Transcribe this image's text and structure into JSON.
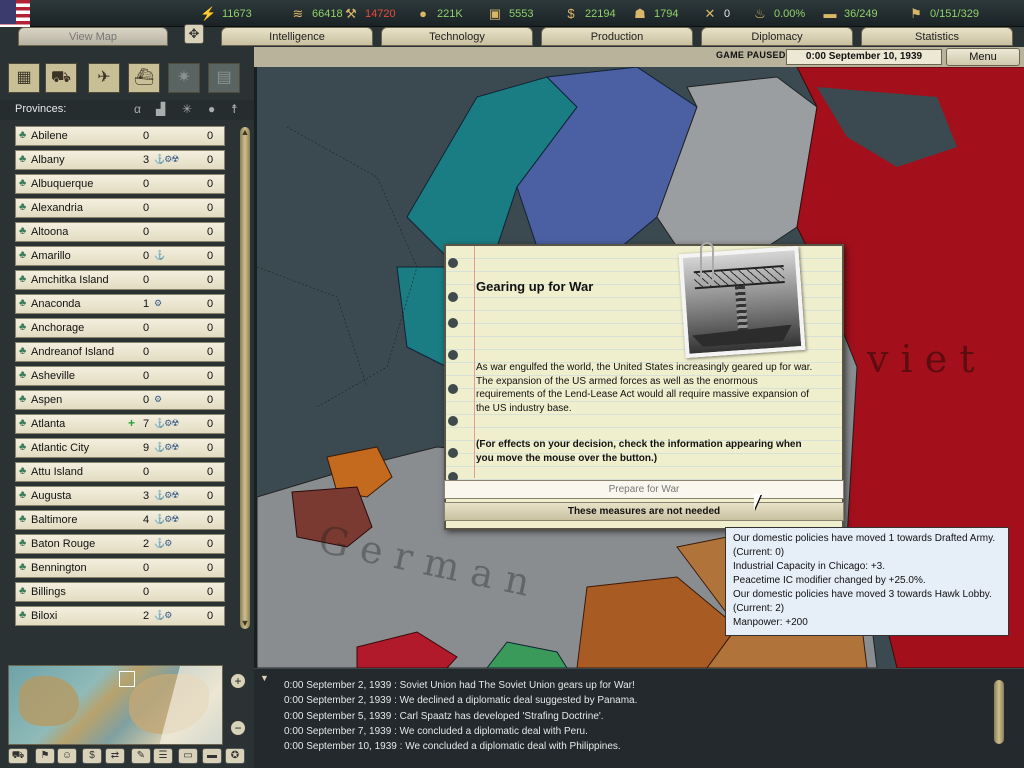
{
  "resources": [
    {
      "name": "energy",
      "icon": "lightning-icon",
      "value": "11673",
      "style": "green",
      "left": 0
    },
    {
      "name": "metal",
      "icon": "metal-bars-icon",
      "value": "66418",
      "style": "green"
    },
    {
      "name": "rare-materials",
      "icon": "rare-materials-icon",
      "value": "14720",
      "style": "red"
    },
    {
      "name": "oil",
      "icon": "oil-drop-icon",
      "value": "221K",
      "style": "green"
    },
    {
      "name": "supplies",
      "icon": "supplies-crate-icon",
      "value": "5553",
      "style": "green"
    },
    {
      "name": "money",
      "icon": "money-icon",
      "value": "22194",
      "style": "green"
    },
    {
      "name": "manpower",
      "icon": "manpower-icon",
      "value": "1794",
      "style": "green"
    },
    {
      "name": "nukes",
      "icon": "nuke-icon",
      "value": "0",
      "style": "white"
    },
    {
      "name": "dissent",
      "icon": "dissent-icon",
      "value": "0.00%",
      "style": "green"
    },
    {
      "name": "transport",
      "icon": "convoy-icon",
      "value": "36/249",
      "style": "green"
    },
    {
      "name": "ic",
      "icon": "industry-icon",
      "value": "0/151/329",
      "style": "green"
    }
  ],
  "tabs": [
    "View Map",
    "Intelligence",
    "Technology",
    "Production",
    "Diplomacy",
    "Statistics"
  ],
  "status": {
    "paused": "GAME PAUSED",
    "date": "0:00 September 10, 1939",
    "menu": "Menu"
  },
  "map_modes": [
    "terrain-mode-icon",
    "land-units-mode-icon",
    "air-mode-icon",
    "naval-mode-icon",
    "weather-mode-icon",
    "supply-mode-icon"
  ],
  "provinces_header": "Provinces:",
  "provinces": [
    {
      "name": "Abilene",
      "v1": "0",
      "icons": "",
      "v2": "0",
      "plus": false
    },
    {
      "name": "Albany",
      "v1": "3",
      "icons": "⚓⚙☢",
      "v2": "0",
      "plus": false
    },
    {
      "name": "Albuquerque",
      "v1": "0",
      "icons": "",
      "v2": "0",
      "plus": false
    },
    {
      "name": "Alexandria",
      "v1": "0",
      "icons": "",
      "v2": "0",
      "plus": false
    },
    {
      "name": "Altoona",
      "v1": "0",
      "icons": "",
      "v2": "0",
      "plus": false
    },
    {
      "name": "Amarillo",
      "v1": "0",
      "icons": "⚓",
      "v2": "0",
      "plus": false
    },
    {
      "name": "Amchitka Island",
      "v1": "0",
      "icons": "",
      "v2": "0",
      "plus": false
    },
    {
      "name": "Anaconda",
      "v1": "1",
      "icons": "⚙",
      "v2": "0",
      "plus": false
    },
    {
      "name": "Anchorage",
      "v1": "0",
      "icons": "",
      "v2": "0",
      "plus": false
    },
    {
      "name": "Andreanof Island",
      "v1": "0",
      "icons": "",
      "v2": "0",
      "plus": false
    },
    {
      "name": "Asheville",
      "v1": "0",
      "icons": "",
      "v2": "0",
      "plus": false
    },
    {
      "name": "Aspen",
      "v1": "0",
      "icons": "⚙",
      "v2": "0",
      "plus": false
    },
    {
      "name": "Atlanta",
      "v1": "7",
      "icons": "⚓⚙☢",
      "v2": "0",
      "plus": true
    },
    {
      "name": "Atlantic City",
      "v1": "9",
      "icons": "⚓⚙☢",
      "v2": "0",
      "plus": false
    },
    {
      "name": "Attu Island",
      "v1": "0",
      "icons": "",
      "v2": "0",
      "plus": false
    },
    {
      "name": "Augusta",
      "v1": "3",
      "icons": "⚓⚙☢",
      "v2": "0",
      "plus": false
    },
    {
      "name": "Baltimore",
      "v1": "4",
      "icons": "⚓⚙☢",
      "v2": "0",
      "plus": false
    },
    {
      "name": "Baton Rouge",
      "v1": "2",
      "icons": "⚓⚙",
      "v2": "0",
      "plus": false
    },
    {
      "name": "Bennington",
      "v1": "0",
      "icons": "",
      "v2": "0",
      "plus": false
    },
    {
      "name": "Billings",
      "v1": "0",
      "icons": "",
      "v2": "0",
      "plus": false
    },
    {
      "name": "Biloxi",
      "v1": "2",
      "icons": "⚓⚙",
      "v2": "0",
      "plus": false
    }
  ],
  "map_labels": {
    "germany": "G e r m a n",
    "soviet": "v i e t"
  },
  "event": {
    "title": "Gearing up for War",
    "body": "As war engulfed the world, the United States increasingly geared up for war.  The expansion of the US armed forces as well as the enormous requirements of the Lend-Lease Act would all require massive expansion of the US industry base.",
    "note": "(For effects on your decision, check the information appearing when you move the mouse over the button.)",
    "choice_a": "Prepare for War",
    "choice_b": "These measures are not needed"
  },
  "tooltip": [
    "Our domestic policies have moved 1 towards Drafted Army. (Current: 0)",
    "Industrial Capacity in Chicago: +3.",
    "Peacetime IC modifier changed by +25.0%.",
    "Our domestic policies have moved 3 towards Hawk Lobby. (Current: 2)",
    "Manpower: +200"
  ],
  "log": [
    "0:00 September 2, 1939 : Soviet Union had The Soviet Union gears up for War!",
    "0:00 September 2, 1939 : We declined a diplomatic deal suggested by Panama.",
    "0:00 September 5, 1939 : Carl Spaatz has developed 'Strafing Doctrine'.",
    "0:00 September 7, 1939 : We concluded a diplomatic deal with Peru.",
    "0:00 September 10, 1939 : We concluded a diplomatic deal with Philippines."
  ],
  "colors": {
    "green_text": "#8fd16a",
    "red_text": "#e84a3a",
    "soviet": "#a3101c",
    "germany": "#8a8d90",
    "sea": "#3a4a50"
  }
}
